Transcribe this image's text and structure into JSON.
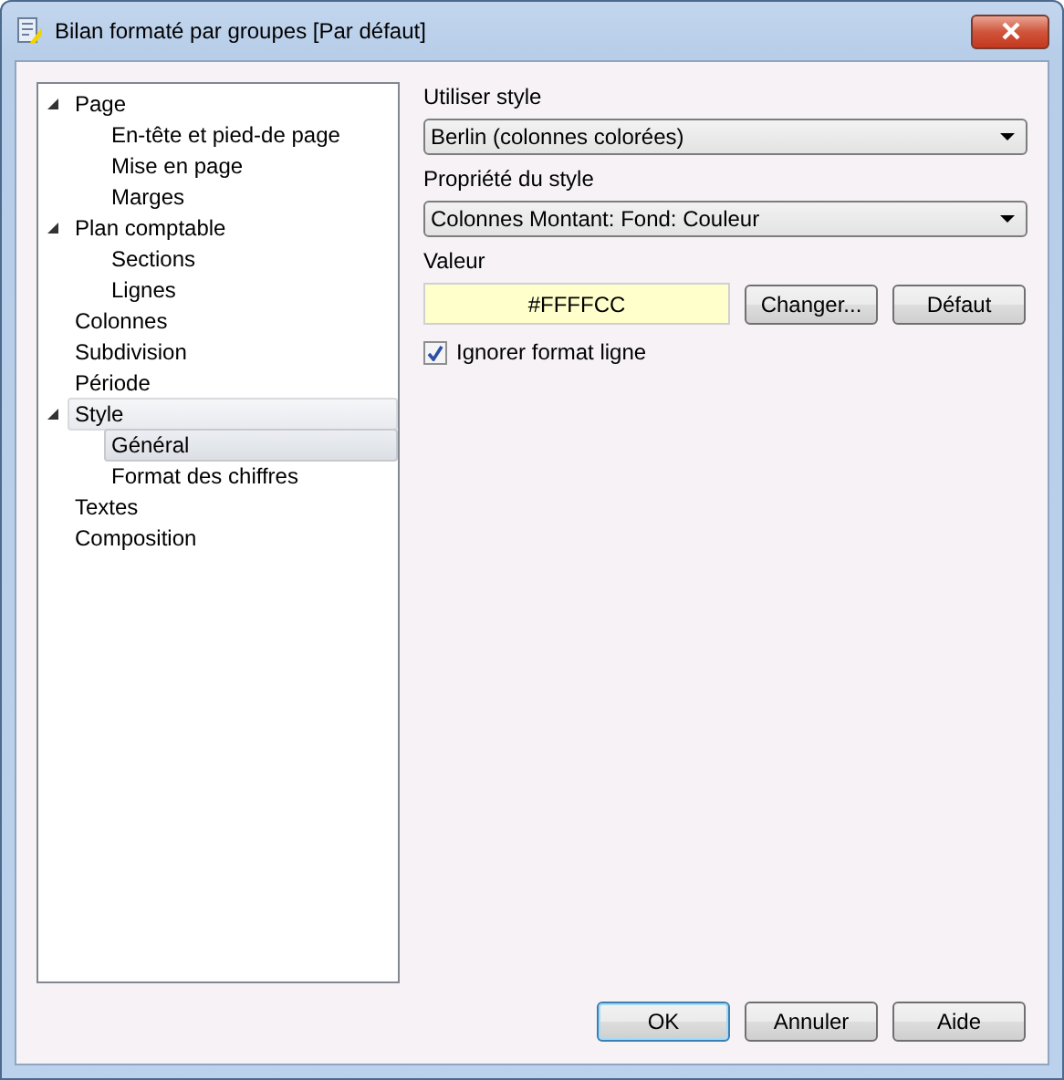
{
  "window": {
    "title": "Bilan formaté par groupes [Par défaut]"
  },
  "tree": [
    {
      "label": "Page",
      "expanded": true,
      "selected": false,
      "highlighted": false,
      "children": [
        {
          "label": "En-tête et pied-de page",
          "selected": false,
          "highlighted": false
        },
        {
          "label": "Mise en page",
          "selected": false,
          "highlighted": false
        },
        {
          "label": "Marges",
          "selected": false,
          "highlighted": false
        }
      ]
    },
    {
      "label": "Plan comptable",
      "expanded": true,
      "selected": false,
      "highlighted": false,
      "children": [
        {
          "label": "Sections",
          "selected": false,
          "highlighted": false
        },
        {
          "label": "Lignes",
          "selected": false,
          "highlighted": false
        }
      ]
    },
    {
      "label": "Colonnes",
      "selected": false,
      "highlighted": false
    },
    {
      "label": "Subdivision",
      "selected": false,
      "highlighted": false
    },
    {
      "label": "Période",
      "selected": false,
      "highlighted": false
    },
    {
      "label": "Style",
      "expanded": true,
      "selected": false,
      "highlighted": true,
      "children": [
        {
          "label": "Général",
          "selected": true,
          "highlighted": true
        },
        {
          "label": "Format des chiffres",
          "selected": false,
          "highlighted": false
        }
      ]
    },
    {
      "label": "Textes",
      "selected": false,
      "highlighted": false
    },
    {
      "label": "Composition",
      "selected": false,
      "highlighted": false
    }
  ],
  "style_select": {
    "label": "Utiliser style",
    "value": "Berlin (colonnes colorées)"
  },
  "property_select": {
    "label": "Propriété du style",
    "value": "Colonnes Montant: Fond: Couleur"
  },
  "value": {
    "label": "Valeur",
    "text": "#FFFFCC",
    "color": "#ffffcc",
    "change_button": "Changer...",
    "default_button": "Défaut"
  },
  "ignore_line_format": {
    "label": "Ignorer format ligne",
    "checked": true
  },
  "buttons": [
    {
      "label": "OK",
      "default": true
    },
    {
      "label": "Annuler",
      "default": false
    },
    {
      "label": "Aide",
      "default": false
    }
  ]
}
